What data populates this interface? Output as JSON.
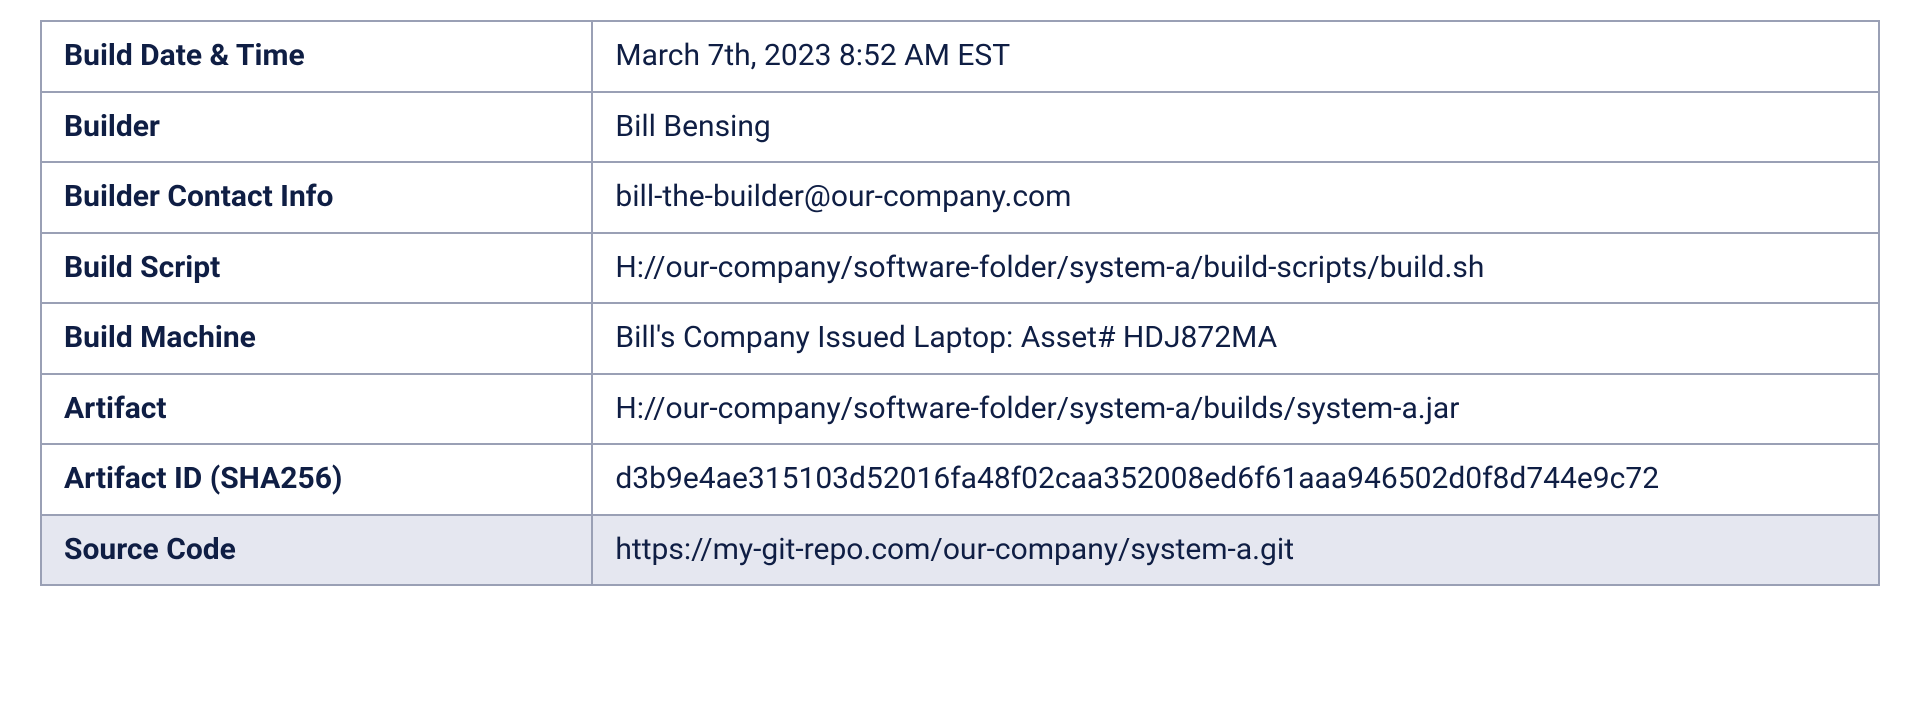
{
  "rows": [
    {
      "label": "Build Date & Time",
      "value": "March 7th, 2023 8:52 AM EST",
      "shaded": false
    },
    {
      "label": "Builder",
      "value": "Bill Bensing",
      "shaded": false
    },
    {
      "label": "Builder Contact Info",
      "value": "bill-the-builder@our-company.com",
      "shaded": false
    },
    {
      "label": "Build Script",
      "value": "H://our-company/software-folder/system-a/build-scripts/build.sh",
      "shaded": false
    },
    {
      "label": "Build Machine",
      "value": "Bill's Company Issued Laptop: Asset# HDJ872MA",
      "shaded": false
    },
    {
      "label": "Artifact",
      "value": "H://our-company/software-folder/system-a/builds/system-a.jar",
      "shaded": false
    },
    {
      "label": "Artifact ID (SHA256)",
      "value": "d3b9e4ae315103d52016fa48f02caa352008ed6f61aaa946502d0f8d744e9c72",
      "shaded": false
    },
    {
      "label": "Source Code",
      "value": "https://my-git-repo.com/our-company/system-a.git",
      "shaded": true
    }
  ]
}
